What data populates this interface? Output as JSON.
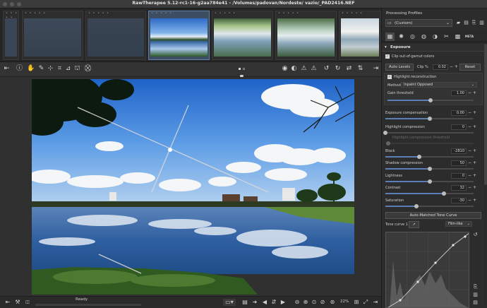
{
  "window": {
    "title": "RawTherapee 5.12-rc1-16-g2aa784e41 - /Volumes/padovan/Nordeste/ vazio/_PAD2416.NEF"
  },
  "filmstrip": {
    "thumbs": [
      {
        "rank": "• • • • •",
        "checked": false
      },
      {
        "rank": "• • • • •",
        "checked": false
      },
      {
        "rank": "• • • • •",
        "checked": true
      },
      {
        "rank": "• • • • •",
        "checked": false,
        "selected": true
      },
      {
        "rank": "• • • • •",
        "checked": false
      },
      {
        "rank": "• • • • •",
        "checked": false
      },
      {
        "rank": "• • • • •",
        "checked": false
      }
    ]
  },
  "status": {
    "text": "Ready",
    "progress": 0.0
  },
  "zoom": {
    "level": "22%"
  },
  "panel": {
    "title": "Processing Profiles",
    "profile": "(Custom)",
    "tabs": [
      "tab-favorites",
      "tab-exposure",
      "tab-detail",
      "tab-color",
      "tab-advanced",
      "tab-transform",
      "tab-raw",
      "tab-metadata"
    ],
    "meta_label": "META",
    "exposure": {
      "header": "Exposure",
      "clip_oog_label": "Clip out-of-gamut colors",
      "clip_oog": true,
      "auto_levels": "Auto Levels",
      "clip_label": "Clip %",
      "clip_value": "0.02",
      "reset": "Reset",
      "highlight_recon_label": "Highlight reconstruction",
      "highlight_recon": true,
      "method_label": "Method",
      "method_value": "Inpaint Opposed",
      "gain_label": "Gain threshold",
      "gain_value": "1.00",
      "hl_comp_threshold_label": "Highlight compression threshold",
      "hl_comp_threshold_value": "0",
      "sliders": [
        {
          "label": "Exposure compensation",
          "value": "0.00",
          "pos": 0.5
        },
        {
          "label": "Highlight compression",
          "value": "0",
          "pos": 0.0
        },
        {
          "label": "Black",
          "value": "-2810",
          "pos": 0.38
        },
        {
          "label": "Shadow compression",
          "value": "50",
          "pos": 0.5
        },
        {
          "label": "Lightness",
          "value": "0",
          "pos": 0.5
        },
        {
          "label": "Contrast",
          "value": "32",
          "pos": 0.66
        },
        {
          "label": "Saturation",
          "value": "-30",
          "pos": 0.35
        }
      ],
      "auto_matched": "Auto-Matched Tone Curve",
      "tone_curve_label": "Tone curve 1",
      "tone_curve_mode": "Film-like"
    }
  },
  "colors": {
    "accent": "#5b7fb5",
    "panel_bg": "#2c2c2c"
  }
}
